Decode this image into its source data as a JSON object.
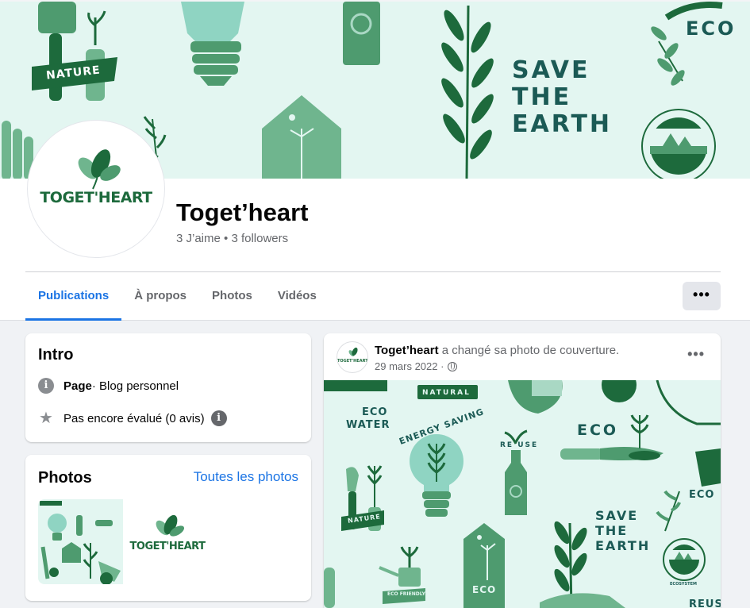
{
  "cover": {
    "nature_label": "NATURE",
    "eco_label": "ECO",
    "save_line1": "SAVE",
    "save_line2": "THE",
    "save_line3": "EARTH"
  },
  "profile": {
    "logo_text": "TOGET'HEART",
    "name": "Toget’heart",
    "stats": "3 J’aime • 3 followers"
  },
  "tabs": [
    {
      "label": "Publications",
      "active": true
    },
    {
      "label": "À propos",
      "active": false
    },
    {
      "label": "Photos",
      "active": false
    },
    {
      "label": "Vidéos",
      "active": false
    }
  ],
  "more_button": "•••",
  "intro": {
    "title": "Intro",
    "category_bold": "Page",
    "category_rest": " · Blog personnel",
    "rating": "Pas encore évalué (0 avis)"
  },
  "photos": {
    "title": "Photos",
    "link": "Toutes les photos"
  },
  "post": {
    "author": "Toget’heart",
    "action": " a changé sa photo de couverture.",
    "date": "29 mars 2022 ·",
    "more": "•••",
    "image_labels": {
      "natural": "NATURAL",
      "eco_water_1": "ECO",
      "eco_water_2": "WATER",
      "energy_saving": "ENERGY SAVING",
      "reuse": "RE USE",
      "eco": "ECO",
      "nature": "NATURE",
      "save1": "SAVE",
      "save2": "THE",
      "save3": "EARTH",
      "eco_bottom": "ECO",
      "eco_friendly": "ECO FRIENDLY",
      "eco_right": "ECO",
      "ecosystem": "ECOSYSTEM",
      "reuse_partial": "REUS"
    }
  },
  "colors": {
    "accent": "#1b74e4",
    "green_dark": "#1b5a55",
    "green_mid": "#4e9b6f",
    "green_light": "#a9d8c4",
    "cover_bg": "#e3f6f1"
  }
}
